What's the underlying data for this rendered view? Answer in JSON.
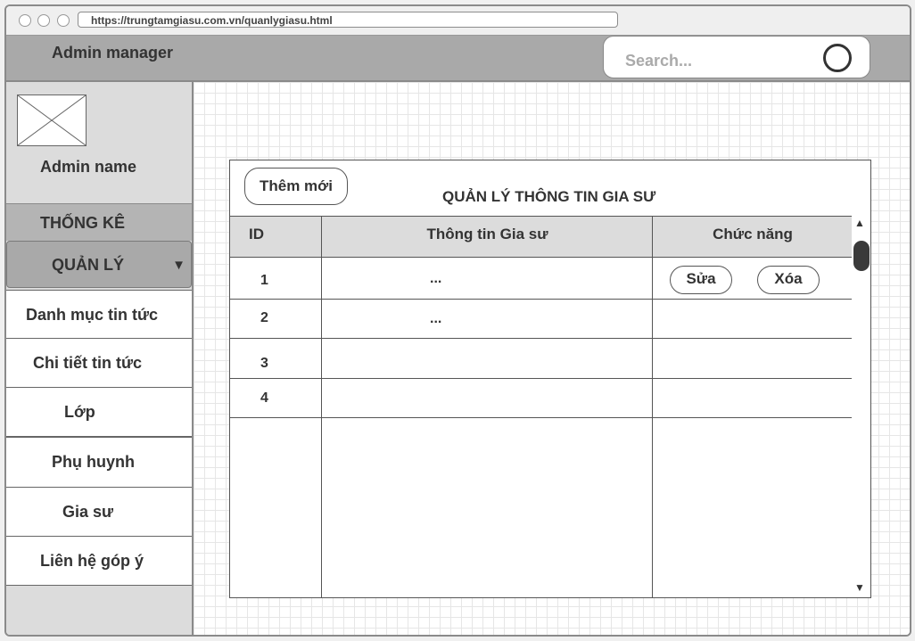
{
  "browser": {
    "url": "https://trungtamgiasu.com.vn/quanlygiasu.html"
  },
  "header": {
    "title": "Admin manager",
    "search_placeholder": "Search..."
  },
  "sidebar": {
    "admin_name": "Admin name",
    "section_stats": "THỐNG KÊ",
    "section_manage": "QUẢN LÝ",
    "caret": "▼",
    "items": [
      {
        "label": "Danh mục tin tức"
      },
      {
        "label": "Chi tiết tin tức"
      },
      {
        "label": "Lớp"
      },
      {
        "label": "Phụ huynh"
      },
      {
        "label": "Gia sư"
      },
      {
        "label": "Liên hệ góp ý"
      }
    ]
  },
  "panel": {
    "add_button": "Thêm mới",
    "title": "QUẢN LÝ THÔNG TIN GIA SƯ",
    "columns": [
      "ID",
      "Thông tin Gia sư",
      "Chức năng"
    ],
    "rows": [
      {
        "id": "1",
        "info": "...",
        "actions": [
          "Sửa",
          "Xóa"
        ]
      },
      {
        "id": "2",
        "info": "..."
      },
      {
        "id": "3",
        "info": ""
      },
      {
        "id": "4",
        "info": ""
      }
    ],
    "scroll_up": "▲",
    "scroll_down": "▼"
  }
}
